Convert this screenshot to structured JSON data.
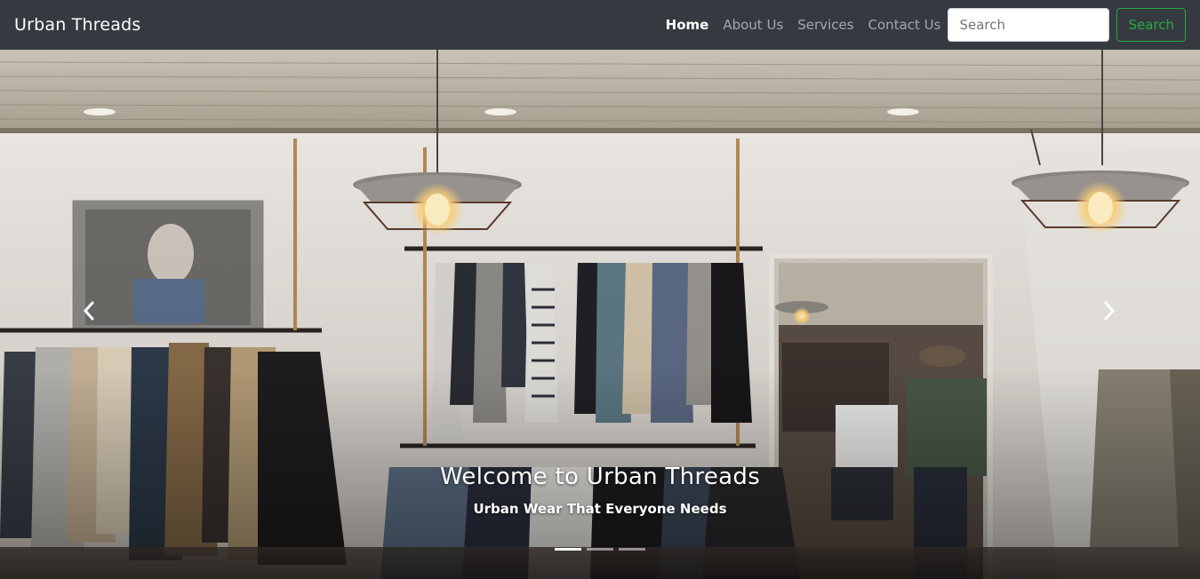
{
  "navbar": {
    "brand": "Urban Threads",
    "links": [
      {
        "label": "Home",
        "active": true
      },
      {
        "label": "About Us",
        "active": false
      },
      {
        "label": "Services",
        "active": false
      },
      {
        "label": "Contact Us",
        "active": false
      }
    ],
    "search": {
      "placeholder": "Search",
      "value": "",
      "button_label": "Search"
    }
  },
  "carousel": {
    "caption_title": "Welcome to Urban Threads",
    "caption_subtitle": "Urban Wear That Everyone Needs",
    "slide_count": 3,
    "active_slide": 1,
    "prev_icon": "chevron-left-icon",
    "next_icon": "chevron-right-icon"
  },
  "colors": {
    "navbar_bg": "#343a40",
    "search_button_accent": "#28a745"
  }
}
